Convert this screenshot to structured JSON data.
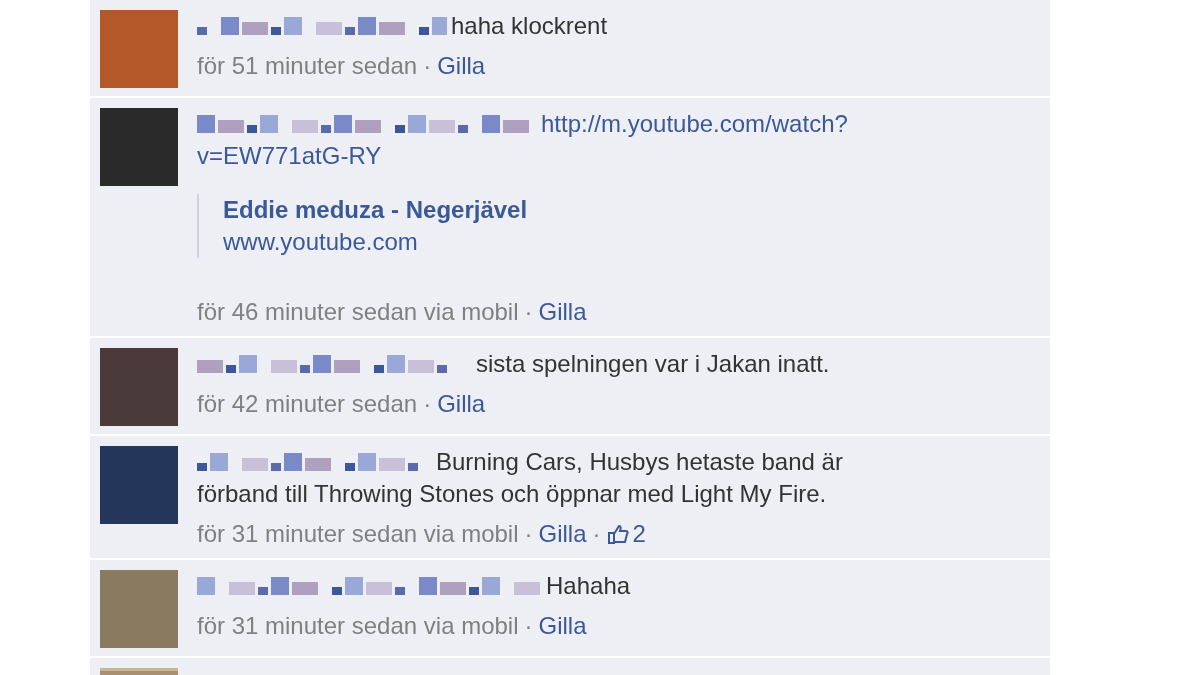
{
  "comments": [
    {
      "kind": "comment",
      "message": "haha klockrent",
      "meta": [
        {
          "kind": "time",
          "text": "för 51 minuter sedan"
        },
        {
          "kind": "sep",
          "text": "·"
        },
        {
          "kind": "link",
          "text": "Gilla"
        }
      ]
    },
    {
      "kind": "comment",
      "link_lines": [
        "http://m.youtube.com/watch?",
        "v=EW771atG-RY"
      ],
      "attachment": {
        "title": "Eddie meduza - Negerjävel",
        "domain": "www.youtube.com"
      },
      "meta": [
        {
          "kind": "time",
          "text": "för 46 minuter sedan via mobil"
        },
        {
          "kind": "sep",
          "text": "·"
        },
        {
          "kind": "link",
          "text": "Gilla"
        }
      ]
    },
    {
      "kind": "comment",
      "message": "sista spelningen var i Jakan inatt.",
      "meta": [
        {
          "kind": "time",
          "text": "för 42 minuter sedan"
        },
        {
          "kind": "sep",
          "text": "·"
        },
        {
          "kind": "link",
          "text": "Gilla"
        }
      ]
    },
    {
      "kind": "comment",
      "message_lines": [
        "Burning Cars, Husbys hetaste band är",
        "förband till Throwing Stones och öppnar med Light My Fire."
      ],
      "meta": [
        {
          "kind": "time",
          "text": "för 31 minuter sedan via mobil"
        },
        {
          "kind": "sep",
          "text": "·"
        },
        {
          "kind": "link",
          "text": "Gilla"
        },
        {
          "kind": "sep",
          "text": "·"
        },
        {
          "kind": "likes",
          "text": "2"
        }
      ]
    },
    {
      "kind": "comment",
      "message": "Hahaha",
      "meta": [
        {
          "kind": "time",
          "text": "för 31 minuter sedan via mobil"
        },
        {
          "kind": "sep",
          "text": "·"
        },
        {
          "kind": "link",
          "text": "Gilla"
        }
      ]
    },
    {
      "kind": "cut_off"
    }
  ]
}
